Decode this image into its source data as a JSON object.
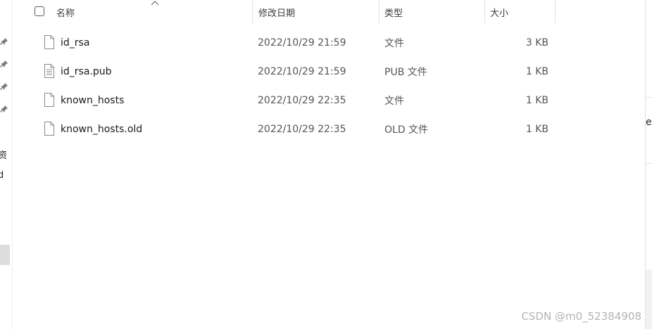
{
  "left_pane": {
    "labels": [
      "资",
      "d"
    ]
  },
  "header": {
    "col_name": "名称",
    "col_modified": "修改日期",
    "col_type": "类型",
    "col_size": "大小"
  },
  "files": [
    {
      "name": "id_rsa",
      "modified": "2022/10/29 21:59",
      "type": "文件",
      "size": "3 KB",
      "icon": "blank-file-icon"
    },
    {
      "name": "id_rsa.pub",
      "modified": "2022/10/29 21:59",
      "type": "PUB 文件",
      "size": "1 KB",
      "icon": "text-file-icon"
    },
    {
      "name": "known_hosts",
      "modified": "2022/10/29 22:35",
      "type": "文件",
      "size": "1 KB",
      "icon": "blank-file-icon"
    },
    {
      "name": "known_hosts.old",
      "modified": "2022/10/29 22:35",
      "type": "OLD 文件",
      "size": "1 KB",
      "icon": "blank-file-icon"
    }
  ],
  "right_pane": {
    "label": "e"
  },
  "watermark": "CSDN @m0_52384908"
}
